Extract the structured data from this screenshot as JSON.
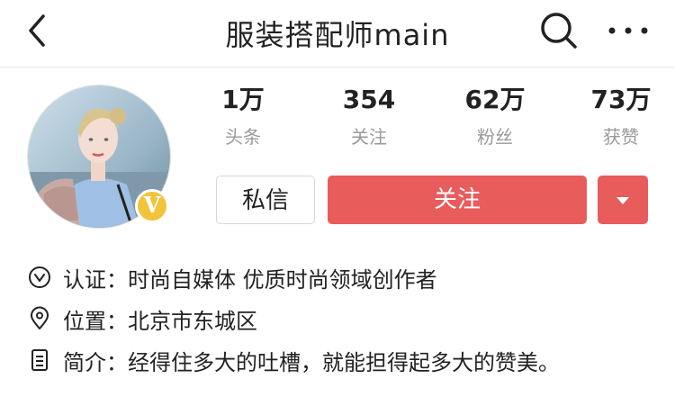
{
  "header": {
    "title": "服装搭配师main",
    "back_icon": "chevron-left-icon",
    "search_icon": "search-icon",
    "more_icon": "more-horizontal-icon"
  },
  "profile": {
    "avatar_alt": "avatar",
    "verified_badge": "V",
    "verified_color": "#f2c43c"
  },
  "stats": [
    {
      "value": "1万",
      "label": "头条"
    },
    {
      "value": "354",
      "label": "关注"
    },
    {
      "value": "62万",
      "label": "粉丝"
    },
    {
      "value": "73万",
      "label": "获赞"
    }
  ],
  "actions": {
    "message_label": "私信",
    "follow_label": "关注",
    "accent_color": "#e85c5c"
  },
  "info": {
    "cert_label": "认证：",
    "cert_value": "时尚自媒体 优质时尚领域创作者",
    "location_label": "位置：",
    "location_value": "北京市东城区",
    "bio_label": "简介：",
    "bio_value": "经得住多大的吐槽，就能担得起多大的赞美。"
  }
}
